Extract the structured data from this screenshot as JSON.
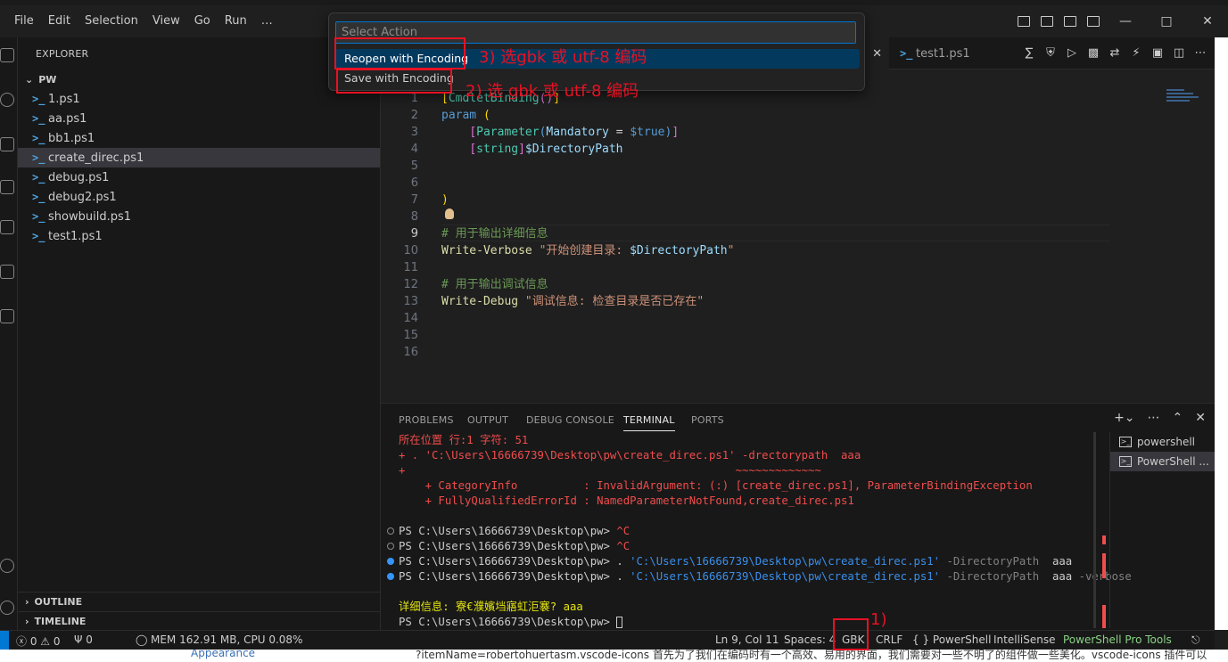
{
  "menu": [
    "File",
    "Edit",
    "Selection",
    "View",
    "Go",
    "Run",
    "…"
  ],
  "window_controls": {
    "minimize": "—",
    "maximize": "□",
    "close": "✕"
  },
  "sidebar": {
    "title": "EXPLORER",
    "folder": "PW",
    "files": [
      "1.ps1",
      "aa.ps1",
      "bb1.ps1",
      "create_direc.ps1",
      "debug.ps1",
      "debug2.ps1",
      "showbuild.ps1",
      "test1.ps1"
    ],
    "selected_file": "create_direc.ps1",
    "outline": "OUTLINE",
    "timeline": "TIMELINE"
  },
  "tabs": {
    "second": "test1.ps1"
  },
  "editor": {
    "line_numbers": [
      "1",
      "2",
      "3",
      "4",
      "5",
      "6",
      "7",
      "8",
      "9",
      "10",
      "11",
      "12",
      "13",
      "14",
      "15",
      "16"
    ],
    "current_line": "9"
  },
  "palette": {
    "placeholder": "Select Action",
    "items": [
      "Reopen with Encoding",
      "Save with Encoding"
    ]
  },
  "panel": {
    "tabs": [
      "PROBLEMS",
      "OUTPUT",
      "DEBUG CONSOLE",
      "TERMINAL",
      "PORTS"
    ],
    "active_tab": "TERMINAL",
    "terminals": [
      "powershell",
      "PowerShell ..."
    ]
  },
  "terminal": {
    "err1": "所在位置 行:1 字符: 51",
    "err2": "+ . 'C:\\Users\\16666739\\Desktop\\pw\\create_direc.ps1' -drectorypath  aaa",
    "err3": "+                                                  ~~~~~~~~~~~~~",
    "err4": "    + CategoryInfo          : InvalidArgument: (:) [create_direc.ps1], ParameterBindingException",
    "err5": "    + FullyQualifiedErrorId : NamedParameterNotFound,create_direc.ps1",
    "ps_prefix": "PS C:\\Users\\16666739\\Desktop\\pw> ",
    "ctrl_c": "^C",
    "dot": ". ",
    "script_path": "'C:\\Users\\16666739\\Desktop\\pw\\create_direc.ps1'",
    "arg_name": " -DirectoryPath ",
    "arg_val": " aaa",
    "verbose_flag": " -verbose",
    "verbose_output": "详细信息: 寮€濮嬪垱寤虹洰褰? aaa",
    "last_prompt": "PS C:\\Users\\16666739\\Desktop\\pw> "
  },
  "statusbar": {
    "problems": "ⓧ 0 ⚠ 0",
    "ports": "Ψ 0",
    "mem": "MEM 162.91 MB, CPU 0.08%",
    "position": "Ln 9, Col 11",
    "spaces": "Spaces: 4",
    "encoding": "GBK",
    "eol": "CRLF",
    "language": "{ } PowerShell",
    "intellisense": "IntelliSense",
    "tools": "PowerShell Pro Tools"
  },
  "annotations": {
    "step1": "1)",
    "step2": "2) 选 gbk 或  utf-8 编码",
    "step3": "3) 选gbk  或 utf-8 编码"
  },
  "background": {
    "appearance": "Appearance",
    "footer_text": "?itemName=robertohuertasm.vscode-icons 首先为了我们在编码时有一个高效、易用的界面，我们需要对一些不明了的组件做一些美化。vscode-icons 插件可以"
  },
  "colors": {
    "accent": "#0078d4",
    "annotation": "#e81123",
    "keyword": "#569cd6",
    "comment": "#6a9955",
    "string": "#ce9178"
  }
}
